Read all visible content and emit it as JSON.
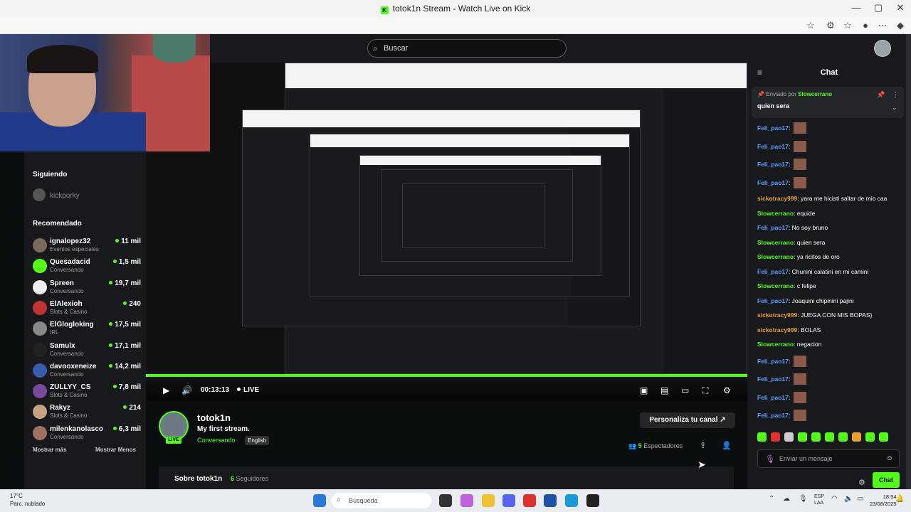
{
  "window": {
    "title": "totok1n Stream - Watch Live on Kick",
    "minimize": "—",
    "maximize": "▢",
    "close": "✕"
  },
  "colors": {
    "accent": "#53fc18",
    "background": "#0b0e0f",
    "panel": "#18191c"
  },
  "search": {
    "placeholder": "Buscar"
  },
  "sidebar": {
    "following_header": "Siguiendo",
    "following_item": "kickporky",
    "recommended_header": "Recomendado",
    "items": [
      {
        "name": "ignalopez32",
        "category": "Eventos especiales",
        "viewers": "11 mil",
        "color": "#7a6a5a"
      },
      {
        "name": "Quesadacid",
        "category": "Conversando",
        "viewers": "1,5 mil",
        "color": "#53fc18"
      },
      {
        "name": "Spreen",
        "category": "Conversando",
        "viewers": "19,7 mil",
        "color": "#eeeeee"
      },
      {
        "name": "ElAlexioh",
        "category": "Slots & Casino",
        "viewers": "240",
        "color": "#c33333"
      },
      {
        "name": "ElGlogloking",
        "category": "IRL",
        "viewers": "17,5 mil",
        "color": "#888888"
      },
      {
        "name": "Samulx",
        "category": "Conversando",
        "viewers": "17,1 mil",
        "color": "#222222"
      },
      {
        "name": "davooxeneize",
        "category": "Conversando",
        "viewers": "14,2 mil",
        "color": "#3a5ab0"
      },
      {
        "name": "ZULLYY_CS",
        "category": "Slots & Casino",
        "viewers": "7,8 mil",
        "color": "#7a4a9a"
      },
      {
        "name": "Rakyz",
        "category": "Slots & Casino",
        "viewers": "214",
        "color": "#c9a080"
      },
      {
        "name": "milenkanolasco",
        "category": "Conversando",
        "viewers": "6,3 mil",
        "color": "#a07060"
      }
    ],
    "show_more": "Mostrar más",
    "show_less": "Mostrar Menos"
  },
  "player": {
    "time": "00:13:13",
    "live": "LIVE",
    "progress": 1.0
  },
  "channel": {
    "name": "totok1n",
    "live_badge": "LIVE",
    "title": "My first stream.",
    "category": "Conversando",
    "language": "English",
    "customize_button": "Personaliza tu canal",
    "viewers_count": "5",
    "viewers_label": "Espectadores",
    "about_title": "Sobre totok1n",
    "followers_count": "6",
    "followers_label": "Seguidores"
  },
  "chat": {
    "title": "Chat",
    "pinned_prefix": "Enviado por",
    "pinned_user": "Slowcerrano",
    "pinned_message": "quien sera",
    "messages": [
      {
        "user": "Feli_pao17",
        "text": "",
        "color": "#5aa0ff",
        "emote": true
      },
      {
        "user": "Feli_pao17",
        "text": "",
        "color": "#5aa0ff",
        "emote": true
      },
      {
        "user": "Feli_pao17",
        "text": "",
        "color": "#5aa0ff",
        "emote": true
      },
      {
        "user": "Feli_pao17",
        "text": "",
        "color": "#5aa0ff",
        "emote": true
      },
      {
        "user": "sickotracy999",
        "text": "yara me hicisti saltar de mio caa",
        "color": "#e8a030",
        "emote": false
      },
      {
        "user": "Slowcerrano",
        "text": "equide",
        "color": "#53fc18",
        "emote": false
      },
      {
        "user": "Feli_pao17",
        "text": "No soy bruno",
        "color": "#5aa0ff",
        "emote": false
      },
      {
        "user": "Slowcerrano",
        "text": "quien sera",
        "color": "#53fc18",
        "emote": false
      },
      {
        "user": "Slowcerrano",
        "text": "ya ricitos de oro",
        "color": "#53fc18",
        "emote": false
      },
      {
        "user": "Feli_pao17",
        "text": "Chunini calatini en mi camini",
        "color": "#5aa0ff",
        "emote": false
      },
      {
        "user": "Slowcerrano",
        "text": "c felipe",
        "color": "#53fc18",
        "emote": false
      },
      {
        "user": "Feli_pao17",
        "text": "Joaquini chipinini pajini",
        "color": "#5aa0ff",
        "emote": false
      },
      {
        "user": "sickotracy999",
        "text": "JUEGA CON MIS BOPAS}",
        "color": "#e8a030",
        "emote": false
      },
      {
        "user": "sickotracy999",
        "text": "BOLAS",
        "color": "#e8a030",
        "emote": false
      },
      {
        "user": "Slowcerrano",
        "text": "negacion",
        "color": "#53fc18",
        "emote": false
      },
      {
        "user": "Feli_pao17",
        "text": "",
        "color": "#5aa0ff",
        "emote": true
      },
      {
        "user": "Feli_pao17",
        "text": "",
        "color": "#5aa0ff",
        "emote": true
      },
      {
        "user": "Feli_pao17",
        "text": "",
        "color": "#5aa0ff",
        "emote": true
      },
      {
        "user": "Feli_pao17",
        "text": "",
        "color": "#5aa0ff",
        "emote": true
      },
      {
        "user": "Feli_pao17",
        "text": "",
        "color": "#5aa0ff",
        "emote": true
      }
    ],
    "input_placeholder": "Enviar un mensaje",
    "send_button": "Chat"
  },
  "taskbar": {
    "temp": "17°C",
    "weather": "Parc. nublado",
    "search_placeholder": "Búsqueda",
    "lang1": "ESP",
    "lang2": "LAA",
    "time": "18:54",
    "date": "23/08/2025"
  }
}
